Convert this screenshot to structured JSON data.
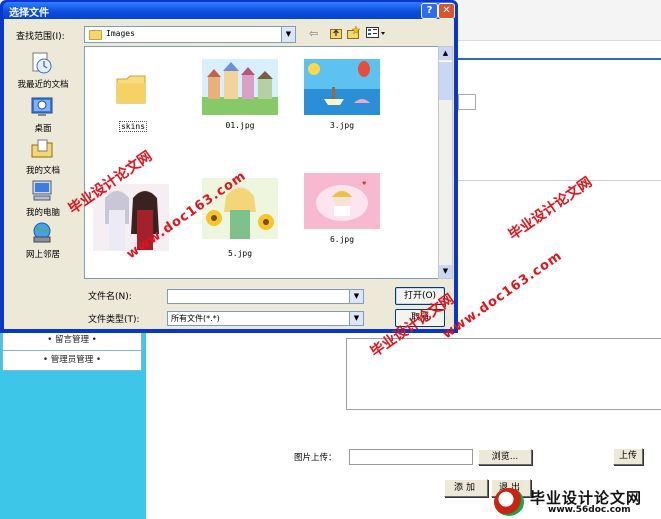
{
  "dialog": {
    "title": "选择文件",
    "help_label": "?",
    "close_label": "✕",
    "look_in_label": "查找范围(I):",
    "look_in_value": "Images",
    "places": [
      {
        "label": "我最近的文档",
        "icon": "recent-documents-icon"
      },
      {
        "label": "桌面",
        "icon": "desktop-icon"
      },
      {
        "label": "我的文档",
        "icon": "my-documents-icon"
      },
      {
        "label": "我的电脑",
        "icon": "my-computer-icon"
      },
      {
        "label": "网上邻居",
        "icon": "network-places-icon"
      }
    ],
    "files": [
      {
        "name": "skins",
        "kind": "folder"
      },
      {
        "name": "01.jpg",
        "kind": "image"
      },
      {
        "name": "3.jpg",
        "kind": "image"
      },
      {
        "name": "",
        "kind": "image"
      },
      {
        "name": "5.jpg",
        "kind": "image"
      },
      {
        "name": "6.jpg",
        "kind": "image"
      }
    ],
    "file_name_label": "文件名(N):",
    "file_name_value": "",
    "file_type_label": "文件类型(T):",
    "file_type_value": "所有文件(*.*)",
    "open_label": "打开(O)",
    "cancel_label": "取消"
  },
  "app": {
    "menu_items": [
      "• 留言管理 •",
      "• 管理员管理 •"
    ],
    "upload_label": "图片上传：",
    "browse_label": "浏览...",
    "upload_button": "上传",
    "add_button": "添加",
    "exit_button": "退出"
  },
  "watermarks": {
    "site_cn": "毕业设计论文网",
    "site_url": "www.doc163.com",
    "footer_cn": "毕业设计论文网",
    "footer_url": "www.56doc.com"
  },
  "colors": {
    "titlebar": "#0a4cdc",
    "sidebar": "#3ec6e9",
    "watermark": "#e0141a",
    "dialog_body": "#ece9d8"
  }
}
